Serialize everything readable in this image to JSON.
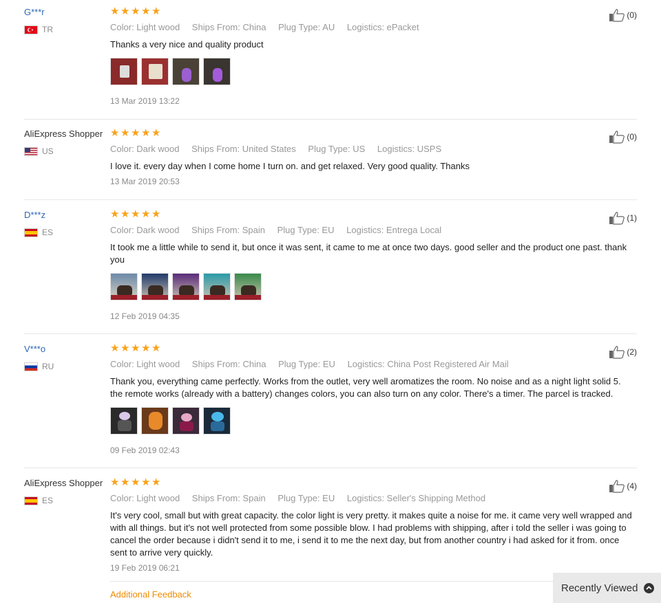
{
  "reviews": [
    {
      "user": "G***r",
      "masked": true,
      "country": "TR",
      "stars": 5,
      "props": [
        "Color: Light wood",
        "Ships From: China",
        "Plug Type: AU",
        "Logistics: ePacket"
      ],
      "text": "Thanks a very nice and quality product",
      "images": 4,
      "date": "13 Mar 2019 13:22",
      "helpful": "(0)"
    },
    {
      "user": "AliExpress Shopper",
      "masked": false,
      "country": "US",
      "stars": 5,
      "props": [
        "Color: Dark wood",
        "Ships From: United States",
        "Plug Type: US",
        "Logistics: USPS"
      ],
      "text": "I love it. every day when I come home I turn on. and get relaxed. Very good quality. Thanks",
      "images": 0,
      "date": "13 Mar 2019 20:53",
      "helpful": "(0)"
    },
    {
      "user": "D***z",
      "masked": true,
      "country": "ES",
      "stars": 5,
      "props": [
        "Color: Dark wood",
        "Ships From: Spain",
        "Plug Type: EU",
        "Logistics: Entrega Local"
      ],
      "text": "It took me a little while to send it, but once it was sent, it came to me at once two days. good seller and the product one past. thank you",
      "images": 5,
      "date": "12 Feb 2019 04:35",
      "helpful": "(1)"
    },
    {
      "user": "V***o",
      "masked": true,
      "country": "RU",
      "stars": 5,
      "props": [
        "Color: Light wood",
        "Ships From: China",
        "Plug Type: EU",
        "Logistics: China Post Registered Air Mail"
      ],
      "text": "Thank you, everything came perfectly. Works from the outlet, very well aromatizes the room. No noise and as a night light solid 5. the remote works (already with a battery) changes colors, you can also turn on any color. There's a timer. The parcel is tracked.",
      "images": 4,
      "date": "09 Feb 2019 02:43",
      "helpful": "(2)"
    },
    {
      "user": "AliExpress Shopper",
      "masked": false,
      "country": "ES",
      "stars": 5,
      "props": [
        "Color: Light wood",
        "Ships From: Spain",
        "Plug Type: EU",
        "Logistics: Seller's Shipping Method"
      ],
      "text": "It's very cool, small but with great capacity. the color light is very pretty. it makes quite a noise for me. it came very well wrapped and with all things. but it's not well protected from some possible blow. I had problems with shipping, after i told the seller i was going to cancel the order because i didn't send it to me, i send it to me the next day, but from another country i had asked for it from. once sent to arrive very quickly.",
      "images": 0,
      "date": "19 Feb 2019 06:21",
      "helpful": "(4)"
    }
  ],
  "additional_feedback": "Additional Feedback",
  "recently_viewed": "Recently Viewed",
  "star_glyph": "★",
  "colors": {
    "star": "#f8a21c",
    "link": "#2d66b3",
    "additional": "#f08c00"
  }
}
